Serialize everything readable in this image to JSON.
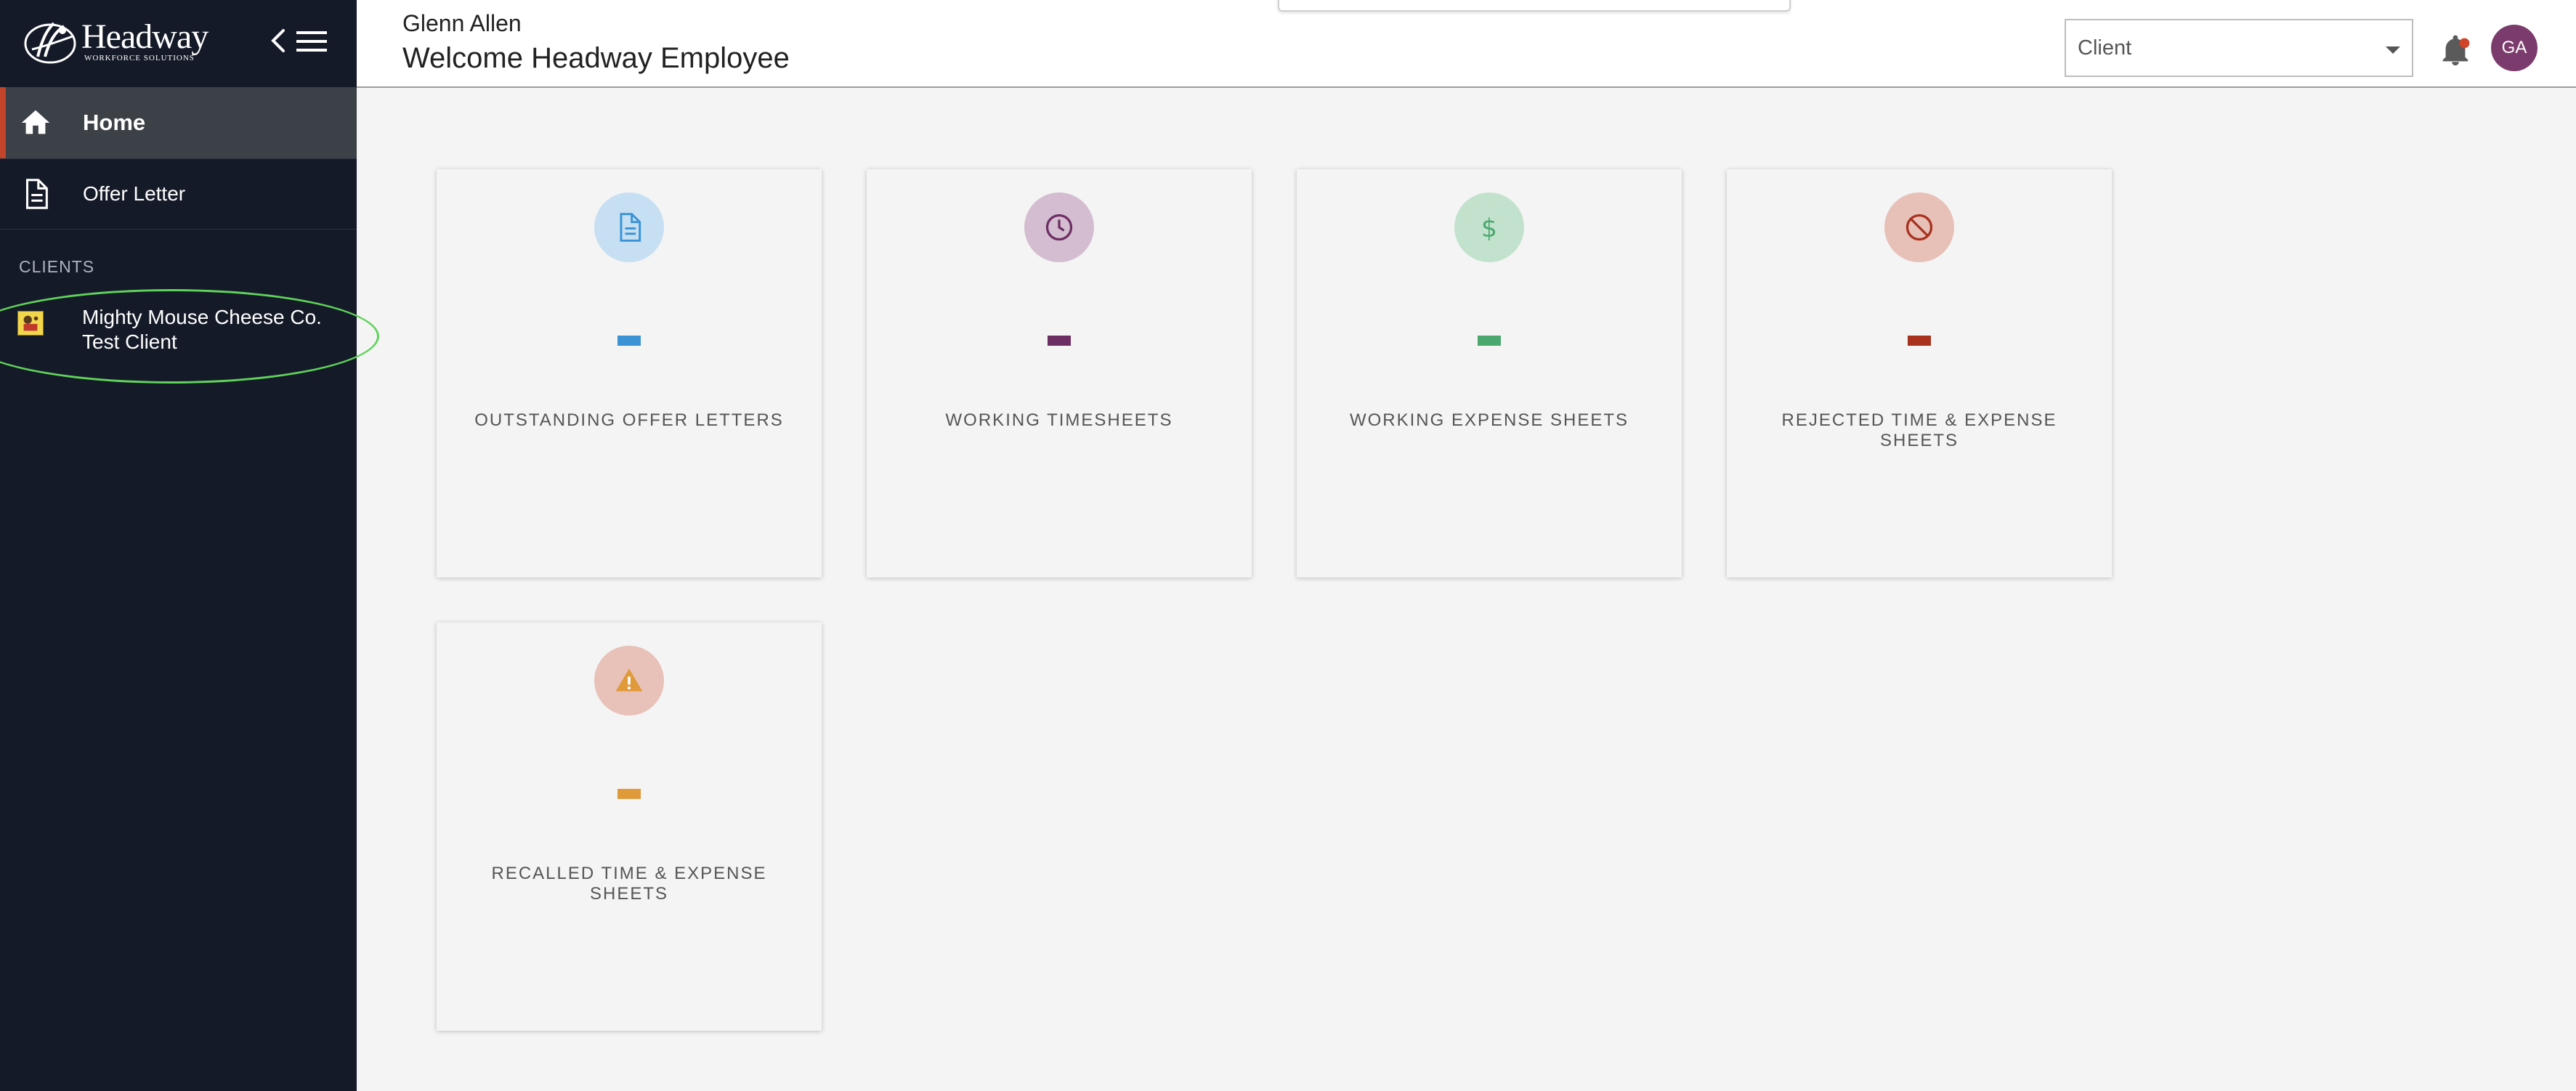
{
  "sidebar": {
    "brand": {
      "name": "Headway",
      "sub": "WORKFORCE SOLUTIONS"
    },
    "nav": [
      {
        "label": "Home",
        "icon": "home-icon",
        "active": true
      },
      {
        "label": "Offer Letter",
        "icon": "document-icon",
        "active": false
      }
    ],
    "clients_heading": "CLIENTS",
    "clients": [
      {
        "name": "Mighty Mouse Cheese Co. Test Client"
      }
    ],
    "accent_color": "#c2442a",
    "background_color": "#151a28"
  },
  "header": {
    "user_name": "Glenn Allen",
    "welcome": "Welcome Headway Employee",
    "client_select": {
      "value": "Client"
    },
    "avatar_initials": "GA",
    "avatar_color": "#7b3b6c"
  },
  "cards": [
    {
      "title": "OUTSTANDING OFFER LETTERS",
      "icon": "document-icon",
      "icon_color": "#3b93d6",
      "circle_color": "#c6dff2",
      "bar_color": "#3b93d6"
    },
    {
      "title": "WORKING TIMESHEETS",
      "icon": "clock-icon",
      "icon_color": "#6d2f63",
      "circle_color": "#d4bdd0",
      "bar_color": "#6d2f63"
    },
    {
      "title": "WORKING EXPENSE SHEETS",
      "icon": "dollar-icon",
      "icon_color": "#4aa86f",
      "circle_color": "#c3e2cd",
      "bar_color": "#4aa86f"
    },
    {
      "title": "REJECTED TIME & EXPENSE SHEETS",
      "icon": "prohibited-icon",
      "icon_color": "#a8321e",
      "circle_color": "#e7c0b8",
      "bar_color": "#a8321e"
    },
    {
      "title": "RECALLED TIME & EXPENSE SHEETS",
      "icon": "warning-icon",
      "icon_color": "#e09a3a",
      "circle_color": "#e8c1b8",
      "bar_color": "#e09a3a"
    }
  ]
}
